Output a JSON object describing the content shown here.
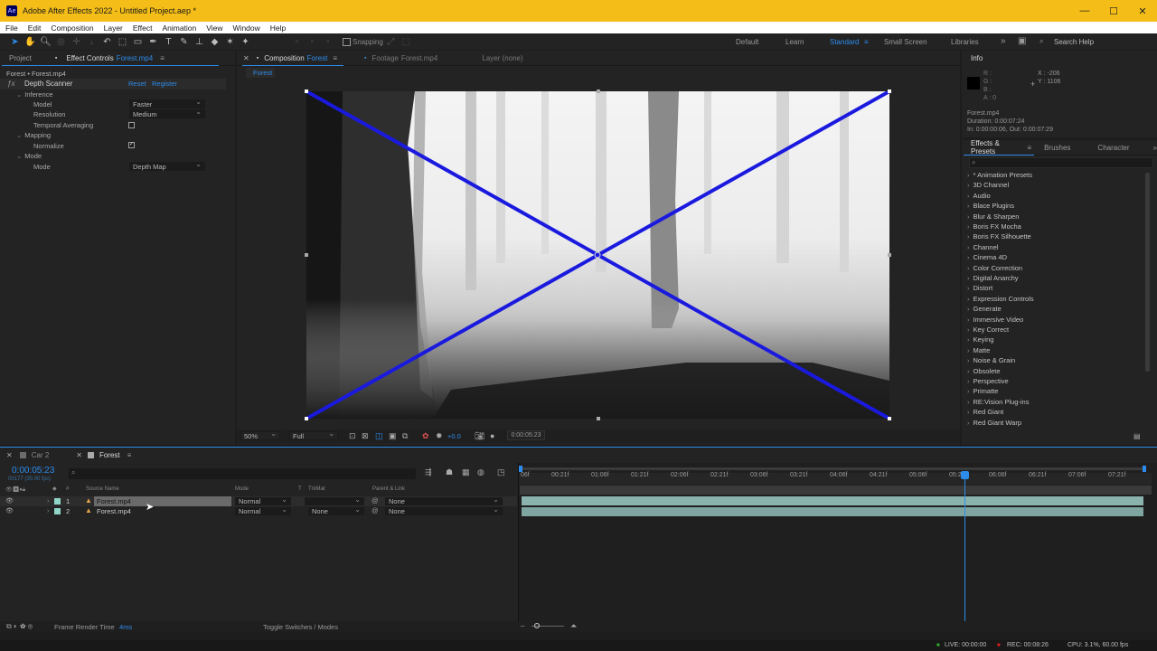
{
  "window": {
    "title": "Adobe After Effects 2022 - Untitled Project.aep *",
    "app_badge": "Ae",
    "controls": [
      "—",
      "☐",
      "✕"
    ]
  },
  "menu": [
    "File",
    "Edit",
    "Composition",
    "Layer",
    "Effect",
    "Animation",
    "View",
    "Window",
    "Help"
  ],
  "toolbar": {
    "snapping_label": "Snapping",
    "workspaces": [
      "Default",
      "Learn",
      "Standard",
      "Small Screen",
      "Libraries"
    ],
    "active_workspace": "Standard",
    "search_help": "Search Help"
  },
  "left_panel": {
    "tabs": [
      "Project",
      "Effect Controls",
      "Forest.mp4"
    ],
    "header": "Forest • Forest.mp4",
    "effect_name": "Depth Scanner",
    "reset": "Reset",
    "register": "Register",
    "groups": {
      "inference": "Inference",
      "mapping": "Mapping",
      "mode_group": "Mode"
    },
    "props": {
      "model_label": "Model",
      "model_value": "Faster",
      "resolution_label": "Resolution",
      "resolution_value": "Medium",
      "temporal_label": "Temporal Averaging",
      "normalize_label": "Normalize",
      "mode_label": "Mode",
      "mode_value": "Depth Map"
    }
  },
  "viewer": {
    "tabs": {
      "composition_prefix": "Composition",
      "composition_name": "Forest",
      "footage_prefix": "Footage",
      "footage_name": "Forest.mp4",
      "layer": "Layer (none)"
    },
    "breadcrumb": "Forest",
    "zoom": "50%",
    "resolution": "Full",
    "exposure": "+0.0",
    "timecode": "0:00:05:23",
    "overlay_color": "#1a1adf"
  },
  "info_panel": {
    "title": "Info",
    "channels": [
      "R :",
      "G :",
      "B :",
      "A : 0"
    ],
    "x": "X : -206",
    "y": "Y : 1106",
    "file": "Forest.mp4",
    "duration": "Duration: 0:00:07:24",
    "in_out": "In: 0:00:00:06, Out: 0:00:07:29"
  },
  "effects_presets": {
    "tabs": [
      "Effects & Presets",
      "Brushes",
      "Character"
    ],
    "search_placeholder": "",
    "items": [
      "* Animation Presets",
      "3D Channel",
      "Audio",
      "Blace Plugins",
      "Blur & Sharpen",
      "Boris FX Mocha",
      "Boris FX Silhouette",
      "Channel",
      "Cinema 4D",
      "Color Correction",
      "Digital Anarchy",
      "Distort",
      "Expression Controls",
      "Generate",
      "Immersive Video",
      "Key Correct",
      "Keying",
      "Matte",
      "Noise & Grain",
      "Obsolete",
      "Perspective",
      "Primatte",
      "RE:Vision Plug-ins",
      "Red Giant",
      "Red Giant Warp"
    ]
  },
  "timeline": {
    "tabs": [
      "Car 2",
      "Forest"
    ],
    "current_time": "0:00:05:23",
    "frame_info": "00177 (30.00 fps)",
    "columns": {
      "source": "Source Name",
      "mode": "Mode",
      "t": "T",
      "trkmat": "TrkMat",
      "parent": "Parent & Link"
    },
    "layers": [
      {
        "num": "1",
        "name": "Forest.mp4",
        "mode": "Normal",
        "trkmat": "",
        "parent": "None"
      },
      {
        "num": "2",
        "name": "Forest.mp4",
        "mode": "Normal",
        "trkmat": "None",
        "parent": "None"
      }
    ],
    "ruler": [
      "06f",
      "00:21f",
      "01:06f",
      "01:21f",
      "02:06f",
      "02:21f",
      "03:06f",
      "03:21f",
      "04:06f",
      "04:21f",
      "05:06f",
      "05:2",
      "06:06f",
      "06:21f",
      "07:06f",
      "07:21f"
    ],
    "frame_render_label": "Frame Render Time",
    "frame_render_value": "4ms",
    "toggle_label": "Toggle Switches / Modes"
  },
  "status": {
    "live": "LIVE: 00:00:00",
    "rec": "REC: 00:08:26",
    "cpu": "CPU: 3.1%, 60.00 fps"
  }
}
